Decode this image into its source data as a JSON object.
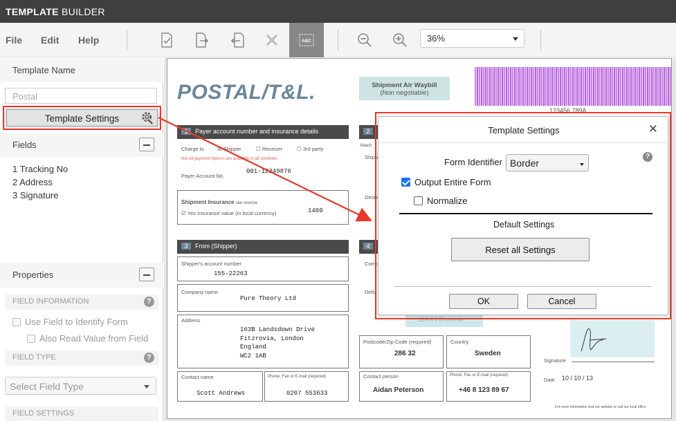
{
  "app": {
    "title_bold": "TEMPLATE",
    "title_rest": "BUILDER"
  },
  "menu": {
    "file": "File",
    "edit": "Edit",
    "help": "Help"
  },
  "toolbar": {
    "zoom_value": "36%"
  },
  "left_panel": {
    "template_name_header": "Template Name",
    "template_name_placeholder": "Postal",
    "template_settings_button": "Template Settings",
    "fields_header": "Fields",
    "fields": [
      "1 Tracking No",
      "2 Address",
      "3 Signature"
    ],
    "properties_header": "Properties",
    "field_information_header": "FIELD INFORMATION",
    "use_field_label": "Use Field to Identify Form",
    "also_read_label": "Also Read Value from Field",
    "field_type_header": "FIELD TYPE",
    "field_type_placeholder": "Select Field Type",
    "field_settings_header": "FIELD SETTINGS"
  },
  "document": {
    "logo": "POSTAL/T&L.",
    "awb_title": "Shipment Air Waybill",
    "awb_sub": "(Non negotiable)",
    "barcode_number": "123456 789A",
    "sec1_num": "1",
    "sec1_title": "Payer account number and insurance details",
    "charge_to": "Charge to",
    "shipper": "Shipper",
    "receiver": "Receiver",
    "third_party": "3rd party",
    "not_all": "Not all payment options are available in all countries.",
    "payer_account": "Payer Account No.",
    "payer_account_value": "001-12349876",
    "shipment_insurance": "Shipment Insurance",
    "see_reverse": "see reverse",
    "yes_insurance": "Yes Insurance value (in local currency)",
    "insurance_value": "1400",
    "sec2_num": "2",
    "sec3_num": "3",
    "sec3_title": "From (Shipper)",
    "sec4_num": "4",
    "shippers_account": "Shipper's account number",
    "shippers_account_value": "155-22263",
    "company_name": "Company name",
    "company_value": "Pure Theory Ltd",
    "address": "Address",
    "address_lines": [
      "163B Landsdown Drive",
      "Fitzrovia, London",
      "England",
      "WC2 1AB"
    ],
    "contact_name": "Contact name",
    "contact_value": "Scott Andrews",
    "phone_label": "Phone, Fax or E-mail (required)",
    "phone_value": "0207 553633",
    "postcode_label": "Postcode/Zip Code (required)",
    "postcode_value": "286 32",
    "country_label": "Country",
    "country_value": "Sweden",
    "contact_person": "Contact person",
    "contact_person_value": "Aidan Peterson",
    "phone_value2": "+46 8 123 89 67",
    "route_code": "12A 04 Bromma",
    "signature": "Signature",
    "date_label": "Date",
    "date_value": "10 / 10 / 13",
    "footer": "For more information visit our website or call our local office",
    "attach": "Attach",
    "ship_frag": "Shipp",
    "dest_frag": "Destir",
    "comp_frag": "Comp",
    "deliv_frag": "Deliv"
  },
  "dialog": {
    "title": "Template Settings",
    "form_identifier_label": "Form Identifier",
    "form_identifier_value": "Border",
    "output_entire_form": "Output Entire Form",
    "output_entire_form_checked": true,
    "normalize": "Normalize",
    "normalize_checked": false,
    "default_settings": "Default Settings",
    "reset_button": "Reset all Settings",
    "ok_button": "OK",
    "cancel_button": "Cancel"
  },
  "colors": {
    "highlight": "#e53a2a",
    "titlebar": "#3f3f3f",
    "checkbox_accent": "#1a73e8",
    "barcode": "#c987e6"
  }
}
